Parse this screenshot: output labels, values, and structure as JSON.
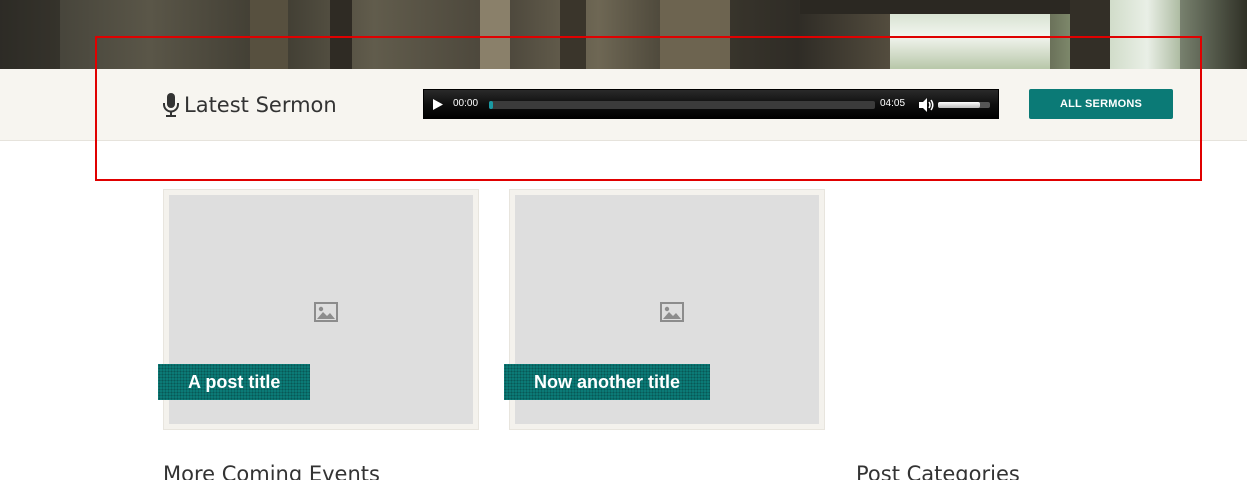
{
  "sermon": {
    "title": "Latest Sermon",
    "icon": "microphone-icon"
  },
  "player": {
    "current_time": "00:00",
    "total_time": "04:05",
    "progress_fraction": 0.01,
    "volume_fraction": 0.8
  },
  "buttons": {
    "all_sermons": "ALL SERMONS"
  },
  "posts": [
    {
      "title": "A post title",
      "image_icon": "image-placeholder-icon"
    },
    {
      "title": "Now another title",
      "image_icon": "image-placeholder-icon"
    }
  ],
  "sections": {
    "events_heading": "More Coming Events",
    "categories_heading": "Post Categories"
  },
  "colors": {
    "accent": "#0b7a76",
    "bar_background": "#f7f5f0",
    "annotation": "#e00000"
  }
}
